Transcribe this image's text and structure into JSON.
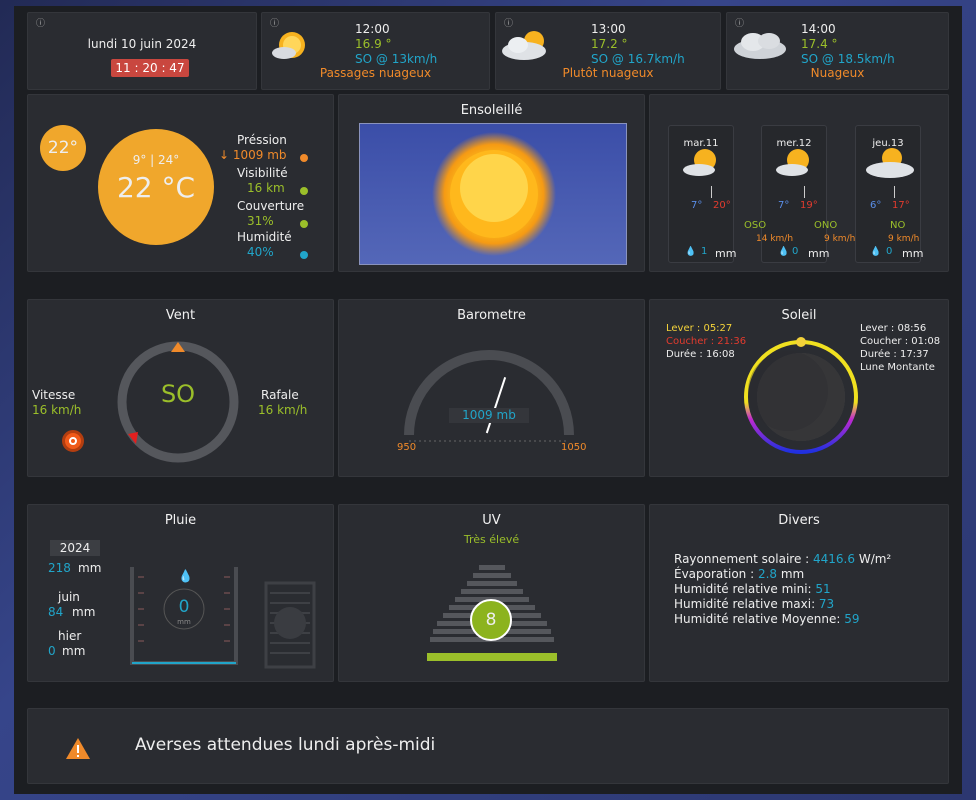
{
  "date": {
    "text": "lundi 10 juin 2024",
    "time": "11 : 20 : 47"
  },
  "forecast": [
    {
      "time": "12:00",
      "temp": "16.9 °",
      "wind": "SO @ 13km/h",
      "desc": "Passages nuageux",
      "icon": "sun-cloud-icon"
    },
    {
      "time": "13:00",
      "temp": "17.2 °",
      "wind": "SO @ 16.7km/h",
      "desc": "Plutôt nuageux",
      "icon": "cloud-sun-icon"
    },
    {
      "time": "14:00",
      "temp": "17.4 °",
      "wind": "SO @ 18.5km/h",
      "desc": "Nuageux",
      "icon": "cloud-icon"
    }
  ],
  "current": {
    "badge": "22°",
    "minmax": "9° | 24°",
    "temp": "22 °C",
    "stats": [
      {
        "label": "Préssion",
        "value": "↓ 1009 mb",
        "color": "#f08a2a"
      },
      {
        "label": "Visibilité",
        "value": "16 km",
        "color": "#9bbf2a"
      },
      {
        "label": "Couverture",
        "value": "31%",
        "color": "#9bbf2a"
      },
      {
        "label": "Humidité",
        "value": "40%",
        "color": "#21a5c9"
      }
    ]
  },
  "sky": {
    "title": "Ensoleillé"
  },
  "days": [
    {
      "day": "mar.11",
      "min": "7°",
      "max": "20°",
      "dir": "",
      "speed": "",
      "rain": "1",
      "unit": "mm"
    },
    {
      "day": "mer.12",
      "min": "7°",
      "max": "19°",
      "dir": "OSO",
      "speed": "14 km/h",
      "rain": "0",
      "unit": "mm"
    },
    {
      "day": "jeu.13",
      "min": "6°",
      "max": "17°",
      "dir": "ONO",
      "speed": "9 km/h",
      "rain": "0",
      "unit": "mm"
    }
  ],
  "day_extra": {
    "dir3": "NO",
    "speed3": "9 km/h"
  },
  "wind": {
    "title": "Vent",
    "dir": "SO",
    "speed_label": "Vitesse",
    "speed": "16 km/h",
    "gust_label": "Rafale",
    "gust": "16 km/h"
  },
  "baro": {
    "title": "Barometre",
    "value": "1009 mb",
    "min": "950",
    "max": "1050",
    "level": 0.59
  },
  "sun": {
    "title": "Soleil",
    "rise": "Lever : 05:27",
    "set": "Coucher : 21:36",
    "dur": "Durée : 16:08",
    "mrise": "Lever : 08:56",
    "mset": "Coucher : 01:08",
    "mdur": "Durée : 17:37",
    "phase": "Lune Montante"
  },
  "rain": {
    "title": "Pluie",
    "year": "2024",
    "year_val": "218",
    "unit": "mm",
    "month": "juin",
    "month_val": "84",
    "yday": "hier",
    "yday_val": "0",
    "gauge": "0",
    "gauge_unit": "mm"
  },
  "uv": {
    "title": "UV",
    "label": "Très élevé",
    "value": "8"
  },
  "misc": {
    "title": "Divers",
    "rows": [
      {
        "label": "Rayonnement solaire : ",
        "value": "4416.6",
        "unit": "  W/m²"
      },
      {
        "label": "Évaporation : ",
        "value": "2.8",
        "unit": "  mm"
      },
      {
        "label": "Humidité relative mini: ",
        "value": "51",
        "unit": ""
      },
      {
        "label": "Humidité relative maxi: ",
        "value": "73",
        "unit": ""
      },
      {
        "label": "Humidité relative Moyenne: ",
        "value": "59",
        "unit": ""
      }
    ]
  },
  "alert": {
    "text": "Averses attendues lundi après-midi"
  },
  "colors": {
    "accent_orange": "#f08a2a",
    "green": "#9bbf2a",
    "cyan": "#21a5c9",
    "red": "#e23b2e"
  }
}
